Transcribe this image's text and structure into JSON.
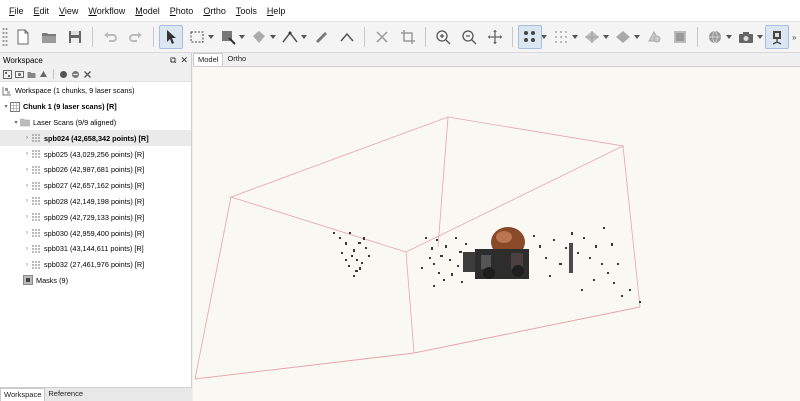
{
  "menu": [
    "File",
    "Edit",
    "View",
    "Workflow",
    "Model",
    "Photo",
    "Ortho",
    "Tools",
    "Help"
  ],
  "toolbar": {
    "more_label": "»"
  },
  "workspace": {
    "title": "Workspace",
    "root_label": "Workspace (1 chunks, 9 laser scans)",
    "chunk_label": "Chunk 1 (9 laser scans) [R]",
    "group_label": "Laser Scans (9/9 aligned)",
    "scans": [
      "spb024 (42,658,342 points) [R]",
      "spb025 (43,029,256 points) [R]",
      "spb026 (42,987,681 points) [R]",
      "spb027 (42,657,162 points) [R]",
      "spb028 (42,149,198 points) [R]",
      "spb029 (42,729,133 points) [R]",
      "spb030 (42,959,400 points) [R]",
      "spb031 (43,144,611 points) [R]",
      "spb032 (27,461,976 points) [R]"
    ],
    "masks_label": "Masks (9)",
    "bottom_tabs": [
      "Workspace",
      "Reference"
    ]
  },
  "view": {
    "tabs": [
      "Model",
      "Ortho"
    ],
    "background_color": "#f9f8f3",
    "bbox_color": "#e8a3ad"
  }
}
